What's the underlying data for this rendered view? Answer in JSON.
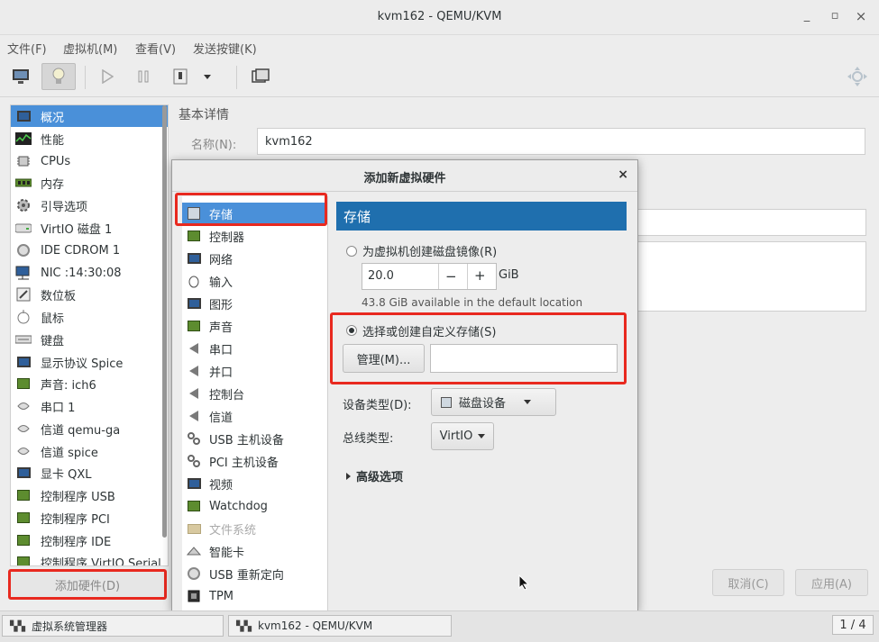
{
  "window": {
    "title": "kvm162 - QEMU/KVM",
    "controls": {
      "minimize": "_",
      "maximize": "▫",
      "close": "×"
    }
  },
  "menubar": [
    "文件(F)",
    "虚拟机(M)",
    "查看(V)",
    "发送按键(K)"
  ],
  "sidebar": {
    "items": [
      {
        "label": "概况",
        "icon": "monitor-icon",
        "selected": true
      },
      {
        "label": "性能",
        "icon": "performance-icon"
      },
      {
        "label": "CPUs",
        "icon": "cpu-icon"
      },
      {
        "label": "内存",
        "icon": "memory-icon"
      },
      {
        "label": "引导选项",
        "icon": "boot-icon"
      },
      {
        "label": "VirtIO 磁盘 1",
        "icon": "disk-icon"
      },
      {
        "label": "IDE CDROM 1",
        "icon": "cdrom-icon"
      },
      {
        "label": "NIC :14:30:08",
        "icon": "nic-icon"
      },
      {
        "label": "数位板",
        "icon": "tablet-icon"
      },
      {
        "label": "鼠标",
        "icon": "mouse-icon"
      },
      {
        "label": "键盘",
        "icon": "keyboard-icon"
      },
      {
        "label": "显示协议 Spice",
        "icon": "display-icon"
      },
      {
        "label": "声音: ich6",
        "icon": "sound-icon"
      },
      {
        "label": "串口 1",
        "icon": "serial-icon"
      },
      {
        "label": "信道 qemu-ga",
        "icon": "channel-icon"
      },
      {
        "label": "信道 spice",
        "icon": "channel-icon"
      },
      {
        "label": "显卡 QXL",
        "icon": "video-icon"
      },
      {
        "label": "控制程序 USB",
        "icon": "controller-icon"
      },
      {
        "label": "控制程序 PCI",
        "icon": "controller-icon"
      },
      {
        "label": "控制程序 IDE",
        "icon": "controller-icon"
      },
      {
        "label": "控制程序 VirtIO Serial",
        "icon": "controller-icon"
      }
    ],
    "add_hardware": "添加硬件(D)"
  },
  "details": {
    "section_title": "基本详情",
    "name_label": "名称(N):",
    "name_value": "kvm162",
    "cancel": "取消(C)",
    "apply": "应用(A)"
  },
  "dialog": {
    "title": "添加新虚拟硬件",
    "close": "×",
    "hardware_list": [
      {
        "label": "存储",
        "icon": "storage-icon",
        "selected": true
      },
      {
        "label": "控制器",
        "icon": "controller-icon"
      },
      {
        "label": "网络",
        "icon": "network-icon"
      },
      {
        "label": "输入",
        "icon": "input-icon"
      },
      {
        "label": "图形",
        "icon": "graphics-icon"
      },
      {
        "label": "声音",
        "icon": "sound-icon"
      },
      {
        "label": "串口",
        "icon": "serial-icon"
      },
      {
        "label": "并口",
        "icon": "parallel-icon"
      },
      {
        "label": "控制台",
        "icon": "console-icon"
      },
      {
        "label": "信道",
        "icon": "channel-icon"
      },
      {
        "label": "USB 主机设备",
        "icon": "usb-host-icon"
      },
      {
        "label": "PCI 主机设备",
        "icon": "pci-host-icon"
      },
      {
        "label": "视频",
        "icon": "video-icon"
      },
      {
        "label": "Watchdog",
        "icon": "watchdog-icon"
      },
      {
        "label": "文件系统",
        "icon": "filesystem-icon",
        "disabled": true
      },
      {
        "label": "智能卡",
        "icon": "smartcard-icon"
      },
      {
        "label": "USB 重新定向",
        "icon": "usb-redirect-icon"
      },
      {
        "label": "TPM",
        "icon": "tpm-icon"
      }
    ],
    "storage": {
      "header": "存储",
      "create_image_label": "为虚拟机创建磁盘镜像(R)",
      "size_value": "20.0",
      "size_unit": "GiB",
      "minus": "−",
      "plus": "+",
      "available_text": "43.8 GiB available in the default location",
      "custom_storage_label": "选择或创建自定义存储(S)",
      "selected_option": "custom",
      "manage_button": "管理(M)...",
      "custom_path_value": "",
      "device_type_label": "设备类型(D):",
      "device_type_value": "磁盘设备",
      "bus_type_label": "总线类型:",
      "bus_type_value": "VirtIO",
      "advanced_label": "高级选项"
    }
  },
  "taskbar": {
    "items": [
      "虚拟系统管理器",
      "kvm162 - QEMU/KVM"
    ],
    "pager": "1 / 4"
  },
  "colors": {
    "selection": "#4a90d9",
    "header": "#1f6fae",
    "highlight_box": "#e8291f"
  }
}
